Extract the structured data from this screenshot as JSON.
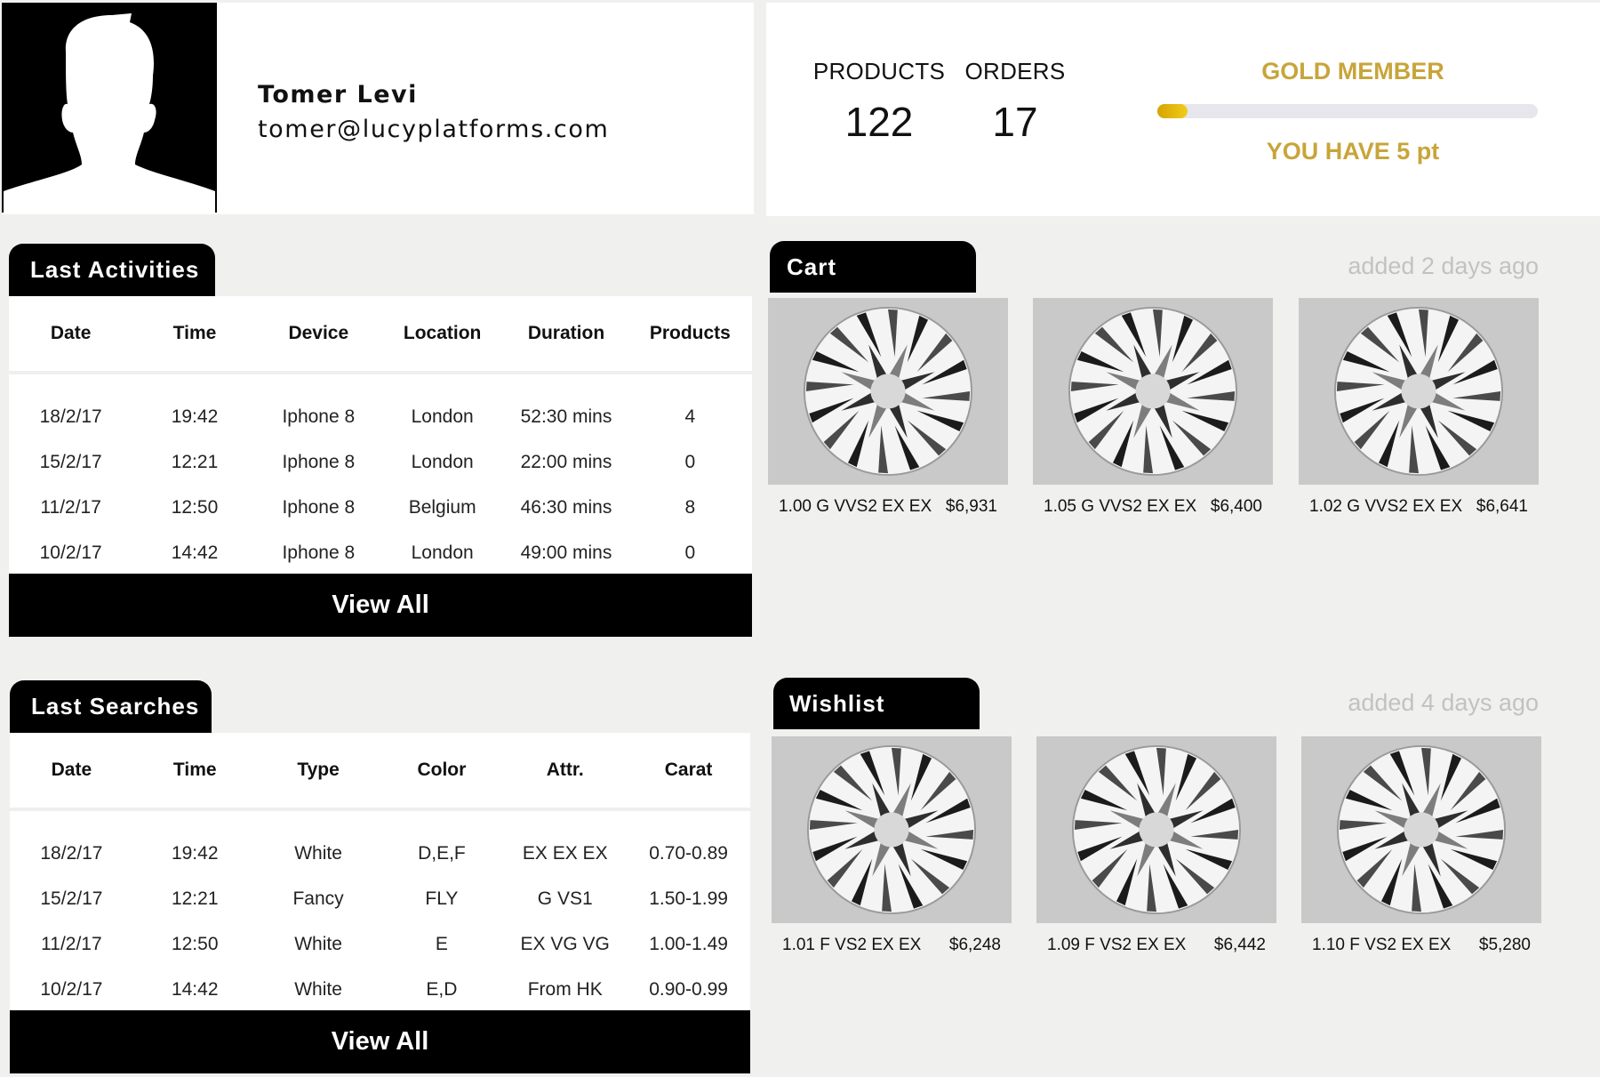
{
  "profile": {
    "name": "Tomer Levi",
    "email": "tomer@lucyplatforms.com"
  },
  "stats": {
    "products_label": "PRODUCTS",
    "products_value": "122",
    "orders_label": "ORDERS",
    "orders_value": "17",
    "membership": "GOLD MEMBER",
    "points_text": "YOU HAVE 5 pt",
    "progress_fraction": 0.08,
    "accent_color": "#c8a53a"
  },
  "activities": {
    "title": "Last Activities",
    "columns": [
      "Date",
      "Time",
      "Device",
      "Location",
      "Duration",
      "Products"
    ],
    "rows": [
      [
        "18/2/17",
        "19:42",
        "Iphone 8",
        "London",
        "52:30 mins",
        "4"
      ],
      [
        "15/2/17",
        "12:21",
        "Iphone 8",
        "London",
        "22:00 mins",
        "0"
      ],
      [
        "11/2/17",
        "12:50",
        "Iphone 8",
        "Belgium",
        "46:30 mins",
        "8"
      ],
      [
        "10/2/17",
        "14:42",
        "Iphone 8",
        "London",
        "49:00 mins",
        "0"
      ]
    ],
    "view_all": "View All"
  },
  "searches": {
    "title": "Last Searches",
    "columns": [
      "Date",
      "Time",
      "Type",
      "Color",
      "Attr.",
      "Carat"
    ],
    "rows": [
      [
        "18/2/17",
        "19:42",
        "White",
        "D,E,F",
        "EX EX EX",
        "0.70-0.89"
      ],
      [
        "15/2/17",
        "12:21",
        "Fancy",
        "FLY",
        "G VS1",
        "1.50-1.99"
      ],
      [
        "11/2/17",
        "12:50",
        "White",
        "E",
        "EX VG VG",
        "1.00-1.49"
      ],
      [
        "10/2/17",
        "14:42",
        "White",
        "E,D",
        "From HK",
        "0.90-0.99"
      ]
    ],
    "view_all": "View All"
  },
  "cart": {
    "title": "Cart",
    "added": "added 2 days ago",
    "items": [
      {
        "desc": "1.00 G VVS2 EX EX",
        "price": "$6,931"
      },
      {
        "desc": "1.05 G VVS2 EX EX",
        "price": "$6,400"
      },
      {
        "desc": "1.02 G VVS2 EX EX",
        "price": "$6,641"
      }
    ]
  },
  "wishlist": {
    "title": "Wishlist",
    "added": "added 4 days ago",
    "items": [
      {
        "desc": "1.01 F VS2 EX EX",
        "price": "$6,248"
      },
      {
        "desc": "1.09 F VS2 EX EX",
        "price": "$6,442"
      },
      {
        "desc": "1.10 F VS2 EX EX",
        "price": "$5,280"
      }
    ]
  }
}
